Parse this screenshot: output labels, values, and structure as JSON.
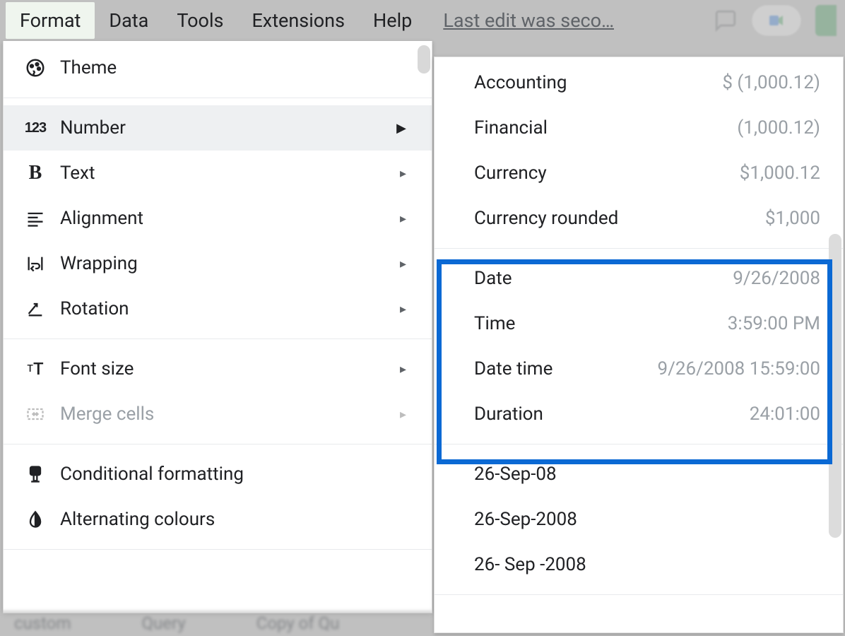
{
  "menubar": {
    "items": [
      "Format",
      "Data",
      "Tools",
      "Extensions",
      "Help"
    ],
    "active_index": 0,
    "last_edit": "Last edit was seco…"
  },
  "primary_menu": {
    "groups": [
      [
        {
          "icon": "theme",
          "label": "Theme",
          "arrow": false
        }
      ],
      [
        {
          "icon": "number",
          "label": "Number",
          "arrow": true,
          "highlight": true
        },
        {
          "icon": "text",
          "label": "Text",
          "arrow": true
        },
        {
          "icon": "alignment",
          "label": "Alignment",
          "arrow": true
        },
        {
          "icon": "wrapping",
          "label": "Wrapping",
          "arrow": true
        },
        {
          "icon": "rotation",
          "label": "Rotation",
          "arrow": true
        }
      ],
      [
        {
          "icon": "fontsize",
          "label": "Font size",
          "arrow": true
        },
        {
          "icon": "merge",
          "label": "Merge cells",
          "arrow": true,
          "disabled": true
        }
      ],
      [
        {
          "icon": "conditional",
          "label": "Conditional formatting",
          "arrow": false
        },
        {
          "icon": "alternating",
          "label": "Alternating colours",
          "arrow": false
        }
      ]
    ]
  },
  "submenu": {
    "items": [
      {
        "label": "Accounting",
        "sample": "$ (1,000.12)"
      },
      {
        "label": "Financial",
        "sample": "(1,000.12)"
      },
      {
        "label": "Currency",
        "sample": "$1,000.12"
      },
      {
        "label": "Currency rounded",
        "sample": "$1,000"
      },
      {
        "divider": true
      },
      {
        "label": "Date",
        "sample": "9/26/2008"
      },
      {
        "label": "Time",
        "sample": "3:59:00 PM"
      },
      {
        "label": "Date time",
        "sample": "9/26/2008 15:59:00"
      },
      {
        "label": "Duration",
        "sample": "24:01:00"
      },
      {
        "divider": true
      },
      {
        "label": "26-Sep-08",
        "sample": ""
      },
      {
        "label": "26-Sep-2008",
        "sample": ""
      },
      {
        "label": "26- Sep -2008",
        "sample": ""
      },
      {
        "divider": true
      }
    ]
  },
  "bottom_tabs": [
    "custom",
    "Query",
    "Copy of Qu"
  ]
}
